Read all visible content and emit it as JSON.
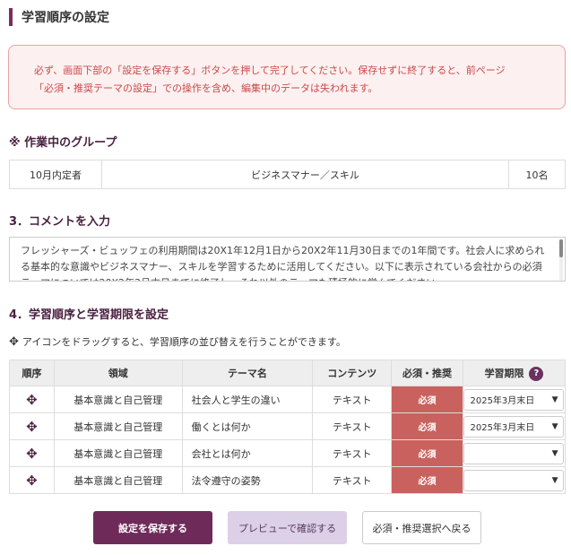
{
  "page": {
    "title": "学習順序の設定",
    "alert_line1": "必ず、画面下部の「設定を保存する」ボタンを押して完了してください。保存せずに終了すると、前ページ",
    "alert_line2": "「必須・推奨テーマの設定」での操作を含め、編集中のデータは失われます。"
  },
  "group": {
    "heading": "※ 作業中のグループ",
    "name": "10月内定者",
    "course": "ビジネスマナー／スキル",
    "count": "10名"
  },
  "comment": {
    "heading": "3．コメントを入力",
    "text": "フレッシャーズ・ビュッフェの利用期間は20X1年12月1日から20X2年11月30日までの1年間です。社会人に求められる基本的な意識やビジネスマナー、スキルを学習するために活用してください。以下に表示されている会社からの必須テーマについては20X2年3月末日までに終了し、それ以外のテーマも積極的に学んでください。"
  },
  "order": {
    "heading": "4．学習順序と学習期限を設定",
    "drag_hint": "アイコンをドラッグすると、学習順序の並び替えを行うことができます。",
    "columns": {
      "order": "順序",
      "domain": "領域",
      "theme": "テーマ名",
      "content": "コンテンツ",
      "required": "必須・推奨",
      "deadline": "学習期限"
    },
    "help_glyph": "?",
    "move_glyph": "✥",
    "rows": [
      {
        "domain": "基本意識と自己管理",
        "theme": "社会人と学生の違い",
        "content": "テキスト",
        "required": "必須",
        "deadline": "2025年3月末日"
      },
      {
        "domain": "基本意識と自己管理",
        "theme": "働くとは何か",
        "content": "テキスト",
        "required": "必須",
        "deadline": "2025年3月末日"
      },
      {
        "domain": "基本意識と自己管理",
        "theme": "会社とは何か",
        "content": "テキスト",
        "required": "必須",
        "deadline": ""
      },
      {
        "domain": "基本意識と自己管理",
        "theme": "法令遵守の姿勢",
        "content": "テキスト",
        "required": "必須",
        "deadline": ""
      }
    ]
  },
  "buttons": {
    "save": "設定を保存する",
    "preview": "プレビューで確認する",
    "back": "必須・推奨選択へ戻る"
  },
  "colors": {
    "accent": "#6e2b5a",
    "required": "#c9625e",
    "alert_text": "#c94a4a"
  }
}
